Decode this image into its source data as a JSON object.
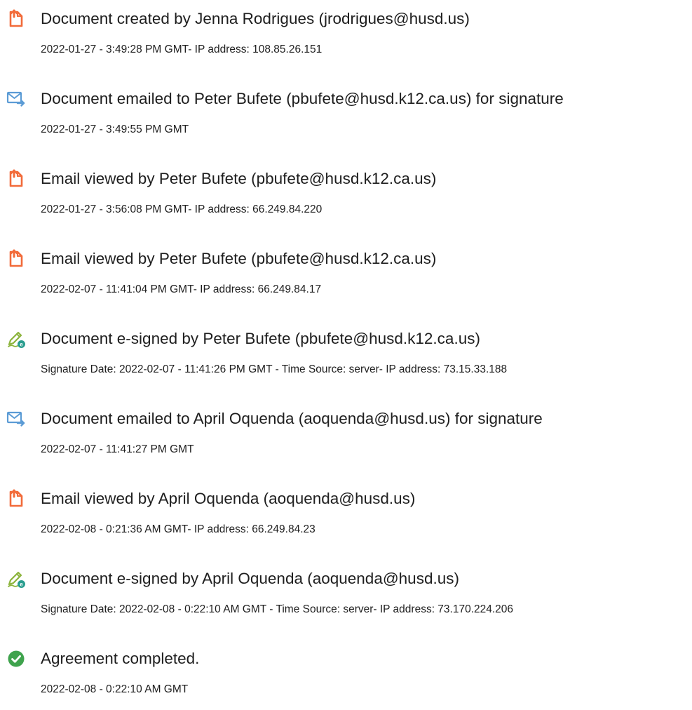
{
  "events": [
    {
      "icon": "document-created-icon",
      "title": "Document created by Jenna Rodrigues (jrodrigues@husd.us)",
      "detail": "2022-01-27 - 3:49:28 PM GMT- IP address: 108.85.26.151"
    },
    {
      "icon": "email-sent-icon",
      "title": "Document emailed to Peter Bufete (pbufete@husd.k12.ca.us) for signature",
      "detail": "2022-01-27 - 3:49:55 PM GMT"
    },
    {
      "icon": "document-viewed-icon",
      "title": "Email viewed by Peter Bufete (pbufete@husd.k12.ca.us)",
      "detail": "2022-01-27 - 3:56:08 PM GMT- IP address: 66.249.84.220"
    },
    {
      "icon": "document-viewed-icon",
      "title": "Email viewed by Peter Bufete (pbufete@husd.k12.ca.us)",
      "detail": "2022-02-07 - 11:41:04 PM GMT- IP address: 66.249.84.17"
    },
    {
      "icon": "esign-pen-icon",
      "title": "Document e-signed by Peter Bufete (pbufete@husd.k12.ca.us)",
      "detail": "Signature Date: 2022-02-07 - 11:41:26 PM GMT - Time Source: server- IP address: 73.15.33.188"
    },
    {
      "icon": "email-sent-icon",
      "title": "Document emailed to April Oquenda (aoquenda@husd.us) for signature",
      "detail": "2022-02-07 - 11:41:27 PM GMT"
    },
    {
      "icon": "document-viewed-icon",
      "title": "Email viewed by April Oquenda (aoquenda@husd.us)",
      "detail": "2022-02-08 - 0:21:36 AM GMT- IP address: 66.249.84.23"
    },
    {
      "icon": "esign-pen-icon",
      "title": "Document e-signed by April Oquenda (aoquenda@husd.us)",
      "detail": "Signature Date: 2022-02-08 - 0:22:10 AM GMT - Time Source: server- IP address: 73.170.224.206"
    },
    {
      "icon": "check-circle-icon",
      "title": "Agreement completed.",
      "detail": "2022-02-08 - 0:22:10 AM GMT"
    }
  ],
  "colors": {
    "document_icon": "#f26b3a",
    "email_icon": "#5b9bd5",
    "esign_pen": "#8cb43c",
    "esign_badge": "#2a9d8f",
    "check": "#3fa34d",
    "text": "#1e1e1e"
  }
}
